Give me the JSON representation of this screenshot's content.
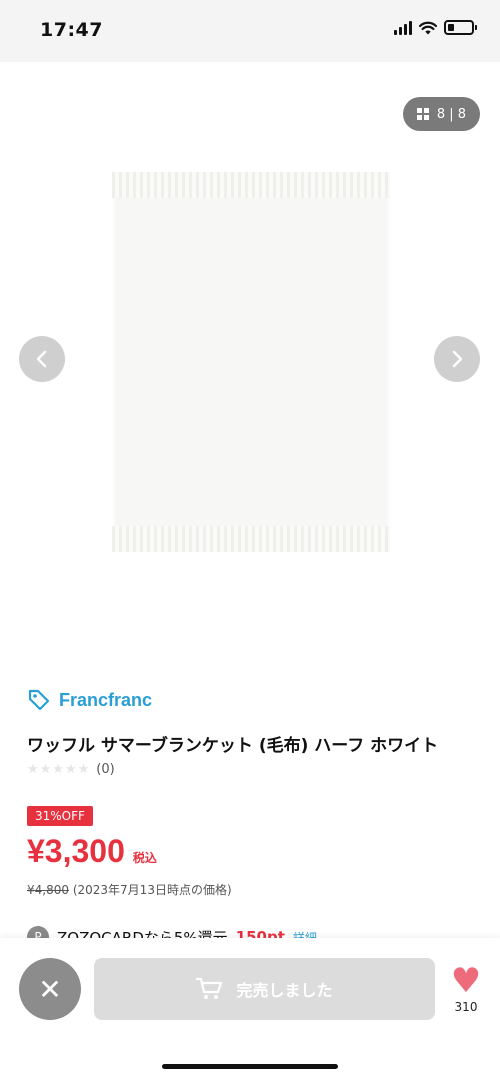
{
  "status_bar": {
    "time": "17:47"
  },
  "gallery": {
    "counter": "8 | 8",
    "prev_icon": "chevron-left-icon",
    "next_icon": "chevron-right-icon"
  },
  "product": {
    "brand": "Francfranc",
    "name": "ワッフル サマーブランケット (毛布) ハーフ ホワイト",
    "stars": "★★★★★",
    "review_count": "(0)",
    "discount_badge": "31%OFF",
    "price": "¥3,300",
    "tax_label": "税込",
    "old_price": "¥4,800",
    "old_price_note": "(2023年7月13日時点の価格)"
  },
  "card_promo": {
    "icon_letter": "P",
    "text": "ZOZOCARDなら5%還元",
    "points": "150pt",
    "detail_link": "詳細"
  },
  "bottom_bar": {
    "close_label": "✕",
    "soldout_label": "完売しました",
    "favorite_count": "310"
  },
  "colors": {
    "brand_blue": "#2a9fd6",
    "sale_red": "#e8313f",
    "heart_pink": "#ee6b7b",
    "disabled_gray": "#dcdcdc"
  }
}
